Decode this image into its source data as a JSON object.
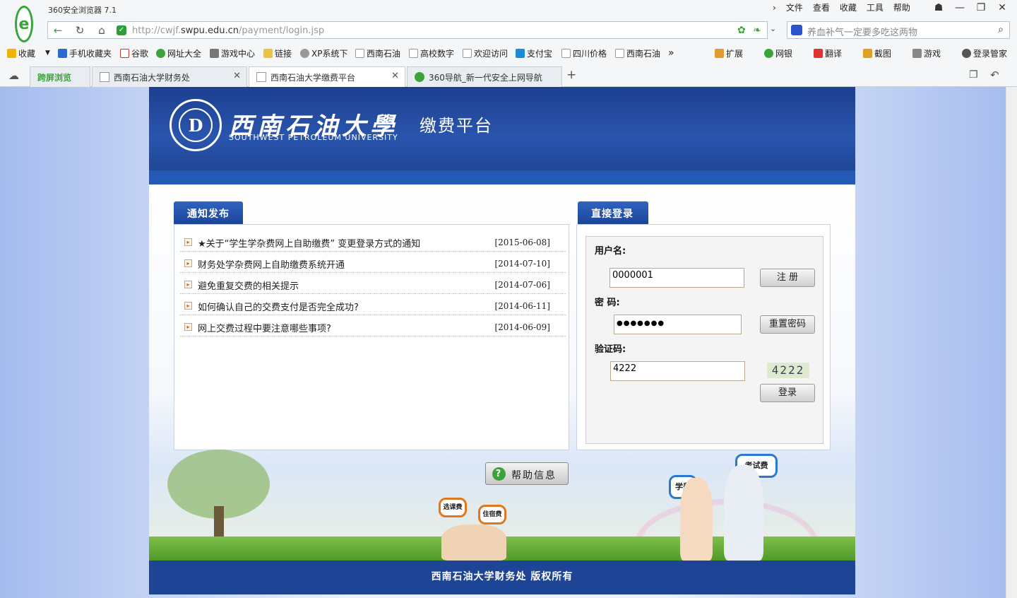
{
  "browser": {
    "title": "360安全浏览器 7.1",
    "menu": [
      "文件",
      "查看",
      "收藏",
      "工具",
      "帮助"
    ],
    "url_prefix": "http://cwjf.",
    "url_domain": "swpu.edu.cn",
    "url_path": "/payment/login.jsp",
    "search_placeholder": "养血补气一定要多吃这两物",
    "favorites": [
      "收藏",
      "手机收藏夹",
      "谷歌",
      "网址大全",
      "游戏中心",
      "链接",
      "XP系统下",
      "西南石油",
      "高校数字",
      "欢迎访问",
      "支付宝",
      "四川价格",
      "西南石油"
    ],
    "tools": [
      "扩展",
      "网银",
      "翻译",
      "截图",
      "游戏",
      "登录管家"
    ],
    "tabs": [
      {
        "label": "跨屏浏览"
      },
      {
        "label": "西南石油大学财务处"
      },
      {
        "label": "西南石油大学缴费平台"
      },
      {
        "label": "360导航_新一代安全上网导航"
      }
    ]
  },
  "header": {
    "university_cn": "西南石油大學",
    "university_en": "SOUTHWEST PETROLEUM UNIVERSITY",
    "platform": "缴费平台"
  },
  "notices": {
    "heading": "通知发布",
    "items": [
      {
        "title": "★关于“学生学杂费网上自助缴费” 变更登录方式的通知",
        "date": "[2015-06-08]"
      },
      {
        "title": "财务处学杂费网上自助缴费系统开通",
        "date": "[2014-07-10]"
      },
      {
        "title": "避免重复交费的相关提示",
        "date": "[2014-07-06]"
      },
      {
        "title": "如何确认自己的交费支付是否完全成功?",
        "date": "[2014-06-11]"
      },
      {
        "title": "网上交费过程中要注意哪些事项?",
        "date": "[2014-06-09]"
      }
    ]
  },
  "login": {
    "heading": "直接登录",
    "username_label": "用户名:",
    "username_value": "0000001",
    "register_label": "注 册",
    "password_label": "密 码:",
    "password_value": "●●●●●●●",
    "reset_label": "重置密码",
    "captcha_label": "验证码:",
    "captcha_value": "4222",
    "captcha_image_text": "4222",
    "submit_label": "登录"
  },
  "help": {
    "label": "帮助信息"
  },
  "scene": {
    "bubbles": [
      "考试费",
      "学费",
      "选课费",
      "住宿费"
    ]
  },
  "footer": {
    "text": "西南石油大学财务处 版权所有"
  }
}
